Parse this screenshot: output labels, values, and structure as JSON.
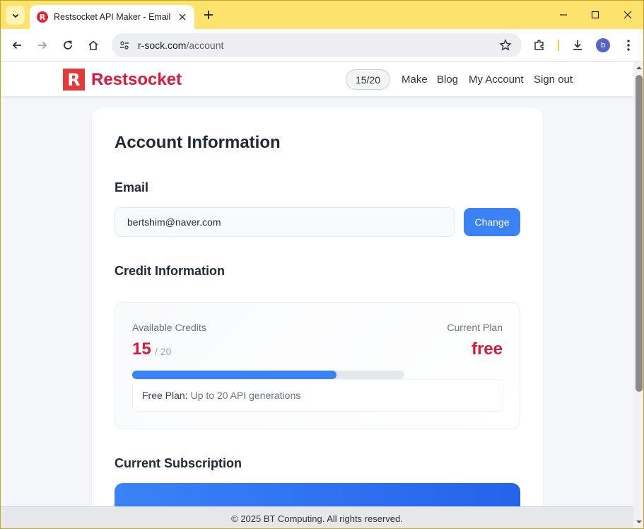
{
  "browser": {
    "tab_title": "Restsocket API Maker - Email",
    "favicon_letter": "R",
    "url_host": "r-sock.com",
    "url_path": "/account",
    "profile_initial": "b"
  },
  "header": {
    "logo_letter": "R",
    "logo_text": "Restsocket",
    "credit_pill": "15/20",
    "nav": [
      "Make",
      "Blog",
      "My Account",
      "Sign out"
    ]
  },
  "account": {
    "title": "Account Information",
    "email_heading": "Email",
    "email_value": "bertshim@naver.com",
    "change_label": "Change",
    "credit_heading": "Credit Information",
    "available_label": "Available Credits",
    "available_value": "15",
    "available_total": "/ 20",
    "plan_label": "Current Plan",
    "plan_value": "free",
    "progress_fraction": 0.75,
    "plan_note_strong": "Free Plan:",
    "plan_note_text": "Up to 20 API generations",
    "subscription_heading": "Current Subscription"
  },
  "footer": {
    "text": "© 2025 BT Computing. All rights reserved."
  },
  "colors": {
    "accent": "#3b82f6",
    "brand": "#d91a3c",
    "titlebar": "#fde36d"
  },
  "icons": [
    "chevron-down-icon",
    "close-icon",
    "plus-icon",
    "minimize-icon",
    "maximize-icon",
    "back-icon",
    "forward-icon",
    "reload-icon",
    "home-icon",
    "site-settings-icon",
    "star-icon",
    "extensions-icon",
    "download-icon",
    "more-icon"
  ]
}
